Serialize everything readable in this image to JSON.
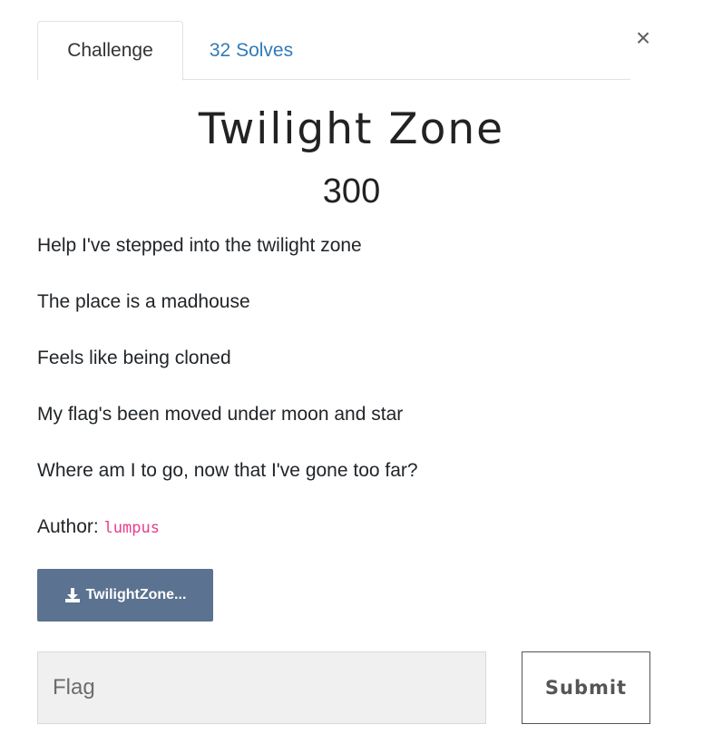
{
  "tabs": {
    "challenge_label": "Challenge",
    "solves_label": "32 Solves"
  },
  "close_label": "×",
  "challenge": {
    "title": "Twilight Zone",
    "points": "300",
    "description_lines": [
      "Help I've stepped into the twilight zone",
      "The place is a madhouse",
      "Feels like being cloned",
      "My flag's been moved under moon and star",
      "Where am I to go, now that I've gone too far?"
    ],
    "author_prefix": "Author: ",
    "author_name": "lumpus",
    "file_label": "TwilightZone..."
  },
  "form": {
    "flag_placeholder": "Flag",
    "submit_label": "Submit"
  },
  "colors": {
    "link": "#337ab7",
    "download_bg": "#5b7290",
    "author_code": "#e83e8c"
  },
  "icons": {
    "download": "download-icon",
    "close": "close-icon"
  }
}
